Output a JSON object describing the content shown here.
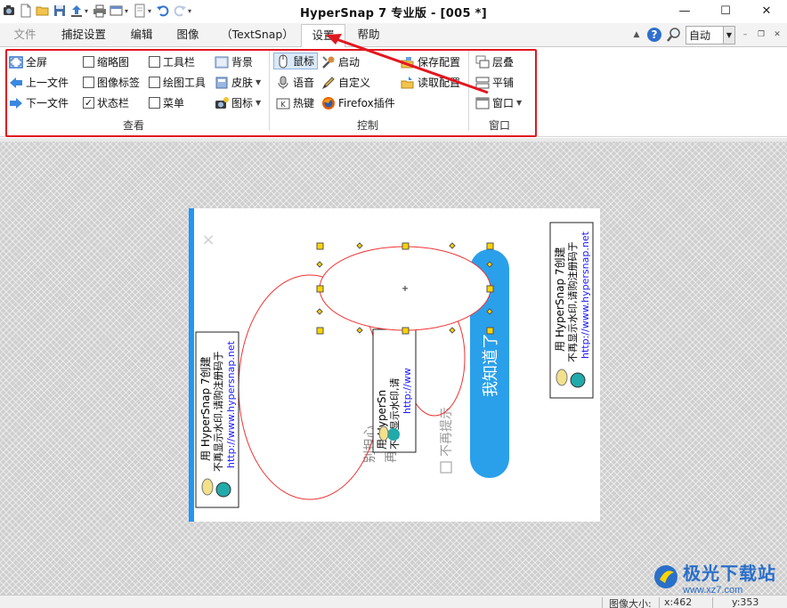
{
  "window": {
    "title": "HyperSnap 7 专业版 - [005 *]",
    "controls": {
      "minimize": "—",
      "maximize": "☐",
      "close": "✕"
    }
  },
  "menu": {
    "tabs": [
      {
        "label": "文件"
      },
      {
        "label": "捕捉设置"
      },
      {
        "label": "编辑"
      },
      {
        "label": "图像"
      },
      {
        "label": "（TextSnap）"
      },
      {
        "label": "设置"
      },
      {
        "label": "帮助"
      }
    ],
    "active_tab": "设置",
    "zoom": {
      "value": "自动"
    }
  },
  "ribbon": {
    "view_group": {
      "label": "查看",
      "nav": [
        {
          "label": "全屏"
        },
        {
          "label": "上一文件"
        },
        {
          "label": "下一文件"
        }
      ],
      "toggles_col1": [
        {
          "label": "缩略图",
          "checked": false
        },
        {
          "label": "图像标签",
          "checked": false
        },
        {
          "label": "状态栏",
          "checked": true
        }
      ],
      "toggles_col2": [
        {
          "label": "工具栏",
          "checked": false
        },
        {
          "label": "绘图工具",
          "checked": false
        },
        {
          "label": "菜单",
          "checked": false
        }
      ],
      "col3": [
        {
          "label": "背景"
        },
        {
          "label": "皮肤"
        },
        {
          "label": "图标"
        }
      ]
    },
    "control_group": {
      "label": "控制",
      "col1": [
        {
          "label": "鼠标"
        },
        {
          "label": "语音"
        },
        {
          "label": "热键"
        }
      ],
      "col2": [
        {
          "label": "启动"
        },
        {
          "label": "自定义"
        },
        {
          "label": "Firefox插件"
        }
      ],
      "col3": [
        {
          "label": "保存配置"
        },
        {
          "label": "读取配置"
        }
      ]
    },
    "window_group": {
      "label": "窗口",
      "items": [
        {
          "label": "层叠"
        },
        {
          "label": "平铺"
        },
        {
          "label": "窗口"
        }
      ]
    }
  },
  "canvas": {
    "popup_button": "我知道了",
    "close_glyph": "×",
    "rotated_text_1": "别担心",
    "rotated_text_2": "再次",
    "checkbox_text": "不再提示",
    "watermark": {
      "line1": "用 HyperSnap 7创建",
      "line2": "不再显示水印,请购注册码于",
      "url": "http://www.hypersnap.net"
    },
    "watermark_mid": {
      "line1": "用 HyperSn",
      "line2": "不再显示水印,请",
      "url": "http://ww"
    }
  },
  "statusbar": {
    "image_size_label": "图像大小:",
    "x_value": "x:462",
    "y_value": "y:353"
  },
  "site_watermark": {
    "name": "极光下载站",
    "url": "www.xz7.com"
  },
  "colors": {
    "highlight_red": "#e2171f",
    "accent_blue": "#2196f3",
    "link_blue": "#1a1aff"
  }
}
